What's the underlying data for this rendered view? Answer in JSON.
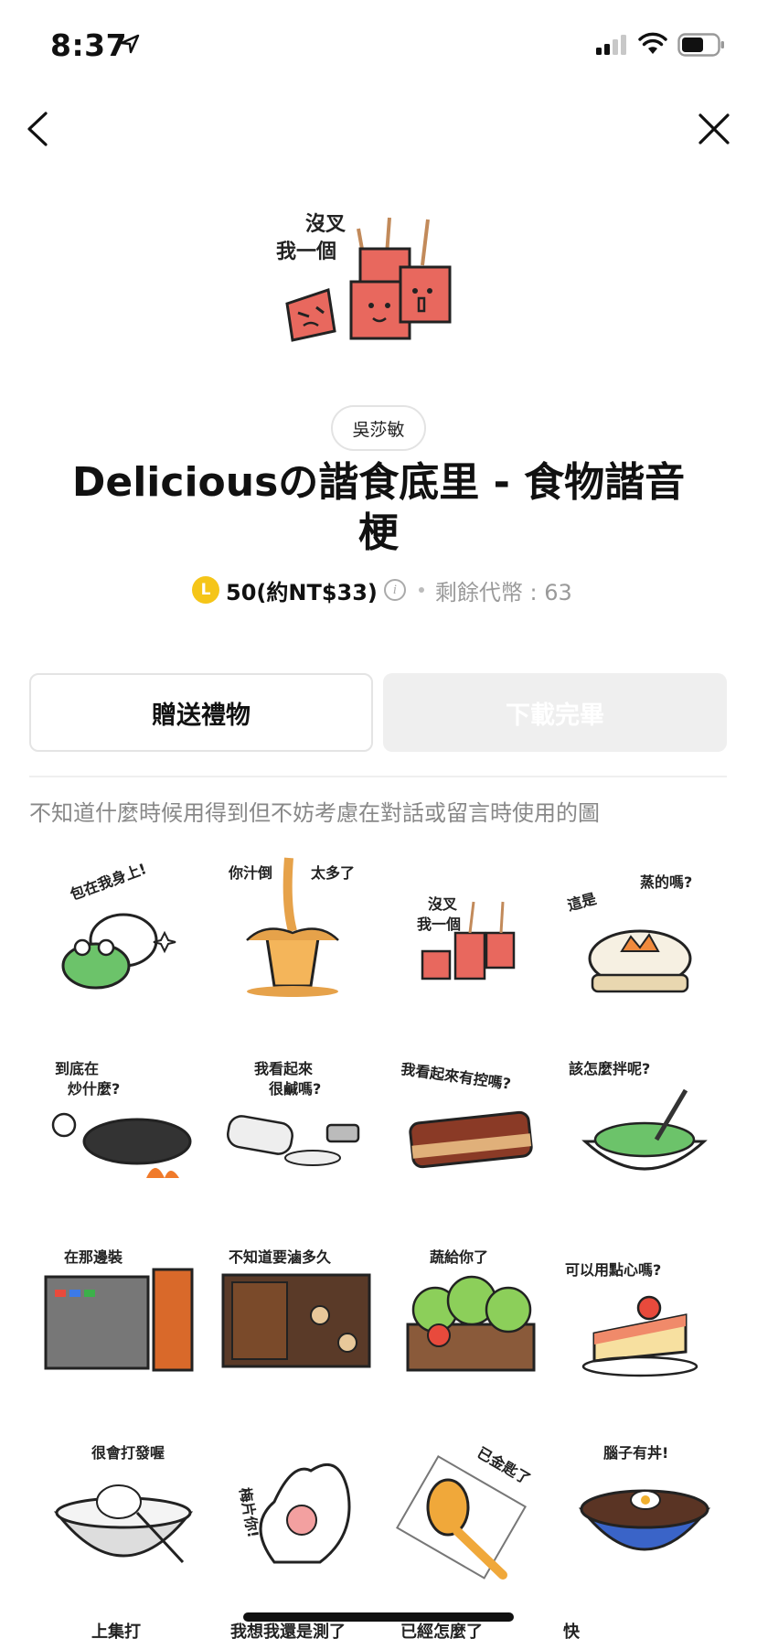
{
  "status_bar": {
    "time": "8:37"
  },
  "pack": {
    "author": "吳莎敏",
    "title": "Deliciousの諧食底里 - 食物諧音梗",
    "hero_text_1": "沒叉",
    "hero_text_2": "我一個",
    "coin_letter": "L",
    "price": "50(約NT$33)",
    "info_glyph": "i",
    "remaining": "剩餘代幣 : 63"
  },
  "buttons": {
    "gift": "贈送禮物",
    "download": "下載完畢"
  },
  "description": "不知道什麼時候用得到但不妨考慮在對話或留言時使用的圖",
  "stickers": [
    {
      "caption": "包在我身上!"
    },
    {
      "caption": "你汁倒",
      "caption2": "太多了"
    },
    {
      "caption": "沒叉",
      "caption2": "我一個"
    },
    {
      "caption": "這是",
      "caption2": "蒸的嗎?"
    },
    {
      "caption": "到底在",
      "caption2": "炒什麼?"
    },
    {
      "caption": "我看起來",
      "caption2": "很鹹嗎?"
    },
    {
      "caption": "我看起來有控嗎?"
    },
    {
      "caption": "該怎麼拌呢?"
    },
    {
      "caption": "在那邊裝"
    },
    {
      "caption": "不知道要滷多久"
    },
    {
      "caption": "蔬給你了"
    },
    {
      "caption": "可以用點心嗎?"
    },
    {
      "caption": "很會打發喔"
    },
    {
      "caption": "梅片你!"
    },
    {
      "caption": "已金匙了"
    },
    {
      "caption": "腦子有丼!"
    }
  ],
  "bottom_peek": [
    "上集打",
    "我想我還是測了",
    "已經怎麼了",
    "快"
  ]
}
